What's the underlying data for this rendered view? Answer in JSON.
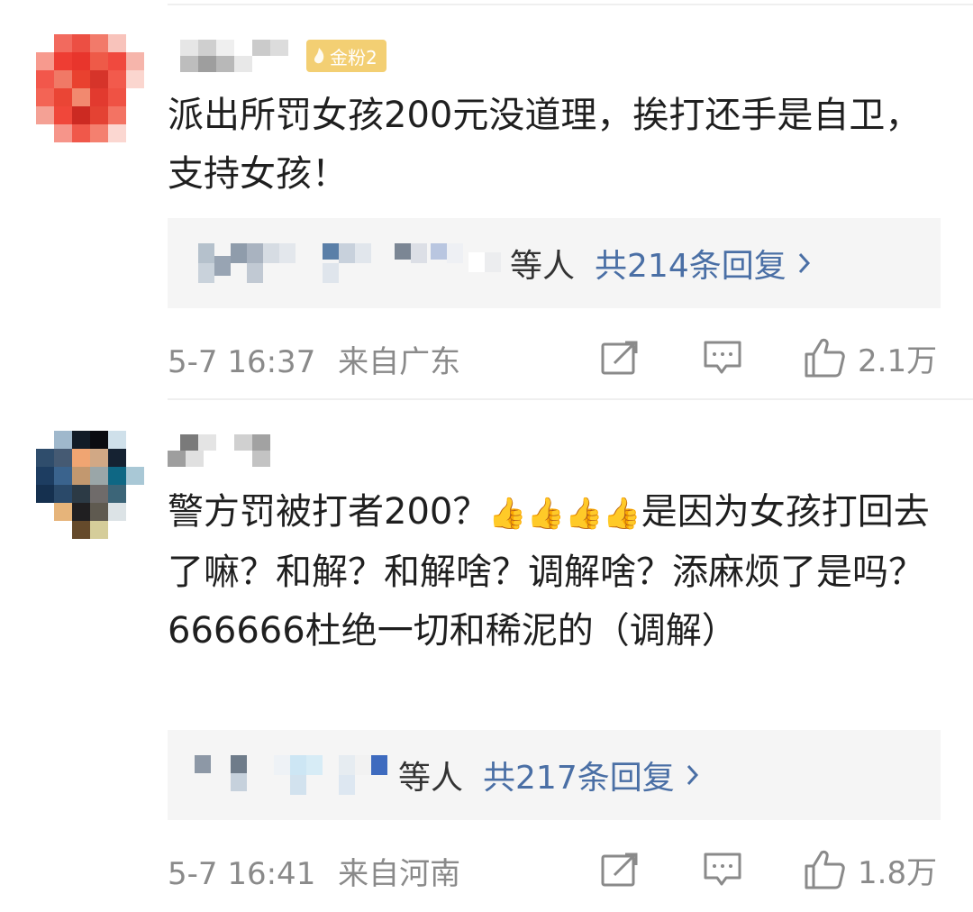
{
  "comments": [
    {
      "badge": "金粉2",
      "text": "派出所罚女孩200元没道理，挨打还手是自卫，支持女孩！",
      "reply_tail": "等人",
      "reply_link": "共214条回复",
      "timestamp": "5-7 16:37",
      "location": "来自广东",
      "likes": "2.1万"
    },
    {
      "text_part1": "警方罚被打者200？",
      "emoji": "👍👍👍👍",
      "text_part2": "是因为女孩打回去了嘛？和解？和解啥？调解啥？添麻烦了是吗？666666杜绝一切和稀泥的（调解）",
      "reply_tail": "等人",
      "reply_link": "共217条回复",
      "timestamp": "5-7 16:41",
      "location": "来自河南",
      "likes": "1.8万"
    }
  ],
  "icons": {
    "share": "share-icon",
    "comment": "comment-icon",
    "like": "thumbs-up-icon",
    "chevron": "chevron-right-icon"
  },
  "colors": {
    "link": "#4a6fa5",
    "meta": "#8a8a8a",
    "badge": "#f3cf73",
    "reply_bg": "#f5f5f5"
  }
}
